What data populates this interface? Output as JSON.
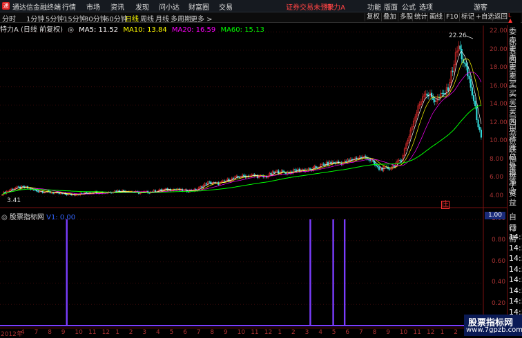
{
  "titlebar": {
    "logo_glyph": "通",
    "app_name": "通达信金融终端",
    "menus": [
      "行情",
      "市场",
      "资讯",
      "发现",
      "问小达",
      "财富圈",
      "交易"
    ],
    "login_status": "证券交易未登录",
    "stock_name": "特 力A",
    "right_menus": [
      "功能",
      "版面",
      "公式",
      "选项",
      "游客"
    ]
  },
  "toolbar": {
    "periods": [
      "分时",
      "1分钟",
      "5分钟",
      "15分钟",
      "30分钟",
      "60分钟",
      "日线",
      "周线",
      "月线",
      "多周期",
      "更多 >"
    ],
    "active_period": "日线",
    "right_buttons": [
      "复权",
      "叠加",
      "多股",
      "统计",
      "画线",
      "F10",
      "标记",
      "+自选",
      "返回"
    ]
  },
  "infobar": {
    "title": "特力A (日线 前复权)",
    "ma5": "MA5: 11.52",
    "ma10": "MA10: 13.84",
    "ma20": "MA20: 16.59",
    "ma60": "MA60: 15.13"
  },
  "colors": {
    "ma5": "#ffffff",
    "ma10": "#ffff00",
    "ma20": "#ff00ff",
    "ma60": "#00ff00",
    "up": "#ff3333",
    "down": "#33dddd",
    "signal": "#7b3dff"
  },
  "chart_data": [
    {
      "type": "candlestick",
      "title": "特力A (日线 前复权)",
      "yaxis_ticks": [
        "22.00",
        "20.00",
        "18.00",
        "16.00",
        "14.00",
        "12.00",
        "10.00",
        "8.00",
        "6.00",
        "4.00"
      ],
      "ylim": [
        3.0,
        22.7
      ],
      "high_label": "22.26",
      "low_label": "3.41",
      "marker_label": "庄",
      "close_series": [
        4.3,
        4.9,
        5.0,
        4.6,
        4.5,
        4.3,
        4.2,
        4.3,
        4.5,
        4.4,
        4.6,
        4.6,
        4.4,
        4.5,
        4.7,
        4.8,
        4.6,
        4.7,
        5.5,
        5.4,
        5.9,
        6.2,
        6.3,
        6.1,
        6.7,
        6.6,
        6.9,
        6.9,
        7.4,
        7.7,
        7.7,
        8.2,
        8.3,
        7.0,
        7.1,
        8.0,
        12.0,
        15.5,
        14.5,
        15.5,
        20.5,
        16.5,
        10.2
      ]
    },
    {
      "type": "bar",
      "title": "股票指标网",
      "series_label": "V1: 0.00",
      "yaxis_ticks": [
        "1.00",
        "0.80",
        "0.60",
        "0.40",
        "0.20"
      ],
      "ylim": [
        0,
        1
      ],
      "signals_at_bar_index": [
        3,
        27,
        29,
        30
      ],
      "values": [
        1,
        1,
        1,
        1
      ]
    }
  ],
  "date_axis": [
    "2012年",
    "4",
    "7",
    "8",
    "9",
    "10",
    "11",
    "12",
    "1",
    "2",
    "3",
    "4",
    "5",
    "6",
    "7",
    "8",
    "9",
    "10",
    "11",
    "12",
    "1",
    "2",
    "3",
    "4",
    "5",
    "6",
    "7",
    "8",
    "9",
    "10",
    "11",
    "12",
    "1",
    "2",
    "420"
  ],
  "right_panel": {
    "items": [
      "委比",
      "卖五",
      "卖四",
      "卖三",
      "卖二",
      "卖一",
      "买一",
      "买二",
      "买三",
      "买四",
      "买五",
      "现价",
      "涨跌",
      "涨幅",
      "总量",
      "外盘",
      "换手",
      "净资",
      "收益"
    ],
    "lower_items": [
      "自动",
      "行情",
      "14:5",
      "14:5",
      "14:5",
      "14:5",
      "14:5",
      "14:5",
      "14:5",
      "14:5"
    ]
  },
  "subpanel": {
    "title": "股票指标网",
    "value": "V1: 0.00",
    "time_box": "1.00"
  },
  "watermark": {
    "line1": "股票指标网",
    "line2": "www.7gpzb.com"
  }
}
